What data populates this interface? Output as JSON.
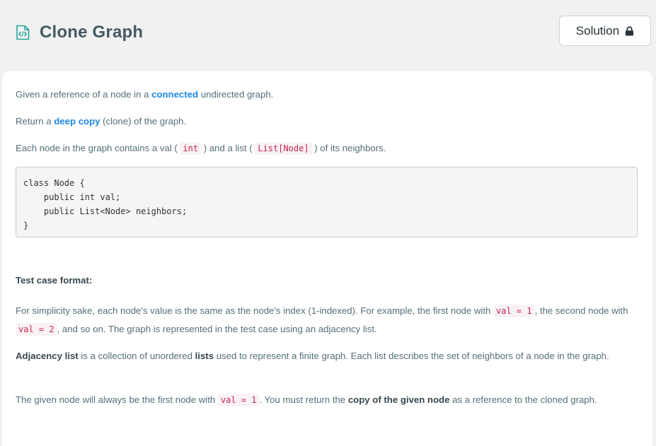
{
  "header": {
    "title": "Clone Graph",
    "title_icon": "code-file-icon",
    "solution_label": "Solution",
    "solution_icon": "lock-icon"
  },
  "description": {
    "p1": {
      "before": "Given a reference of a node in a ",
      "link": "connected",
      "after": " undirected graph."
    },
    "p2": {
      "before": "Return a ",
      "link": "deep copy",
      "after": " (clone) of the graph."
    },
    "p3": {
      "before": "Each node in the graph contains a val ( ",
      "code1": "int",
      "middle": " ) and a list ( ",
      "code2": "List[Node]",
      "after": " ) of its neighbors."
    },
    "code_block": "class Node {\n    public int val;\n    public List<Node> neighbors;\n}"
  },
  "test_case": {
    "title": "Test case format:",
    "p1": {
      "t1": "For simplicity sake, each node's value is the same as the node's index (1-indexed). For example, the first node with ",
      "c1": "val = 1",
      "t2": ", the second node with ",
      "c2": "val = 2",
      "t3": ", and so on. The graph is represented in the test case using an adjacency list."
    },
    "p2": {
      "b1": "Adjacency list",
      "t1": " is a collection of unordered ",
      "b2": "lists",
      "t2": " used to represent a finite graph. Each list describes the set of neighbors of a node in the graph."
    },
    "p3": {
      "t1": "The given node will always be the first node with ",
      "c1": "val = 1",
      "t2": ". You must return the ",
      "b1": "copy of the given node",
      "t3": " as a reference to the cloned graph."
    }
  },
  "colors": {
    "page_bg": "#f1f1f1",
    "link": "#1e88e5",
    "code_text": "#c7254e",
    "code_bg": "#f9f2f4",
    "icon_teal": "#26a69a"
  }
}
